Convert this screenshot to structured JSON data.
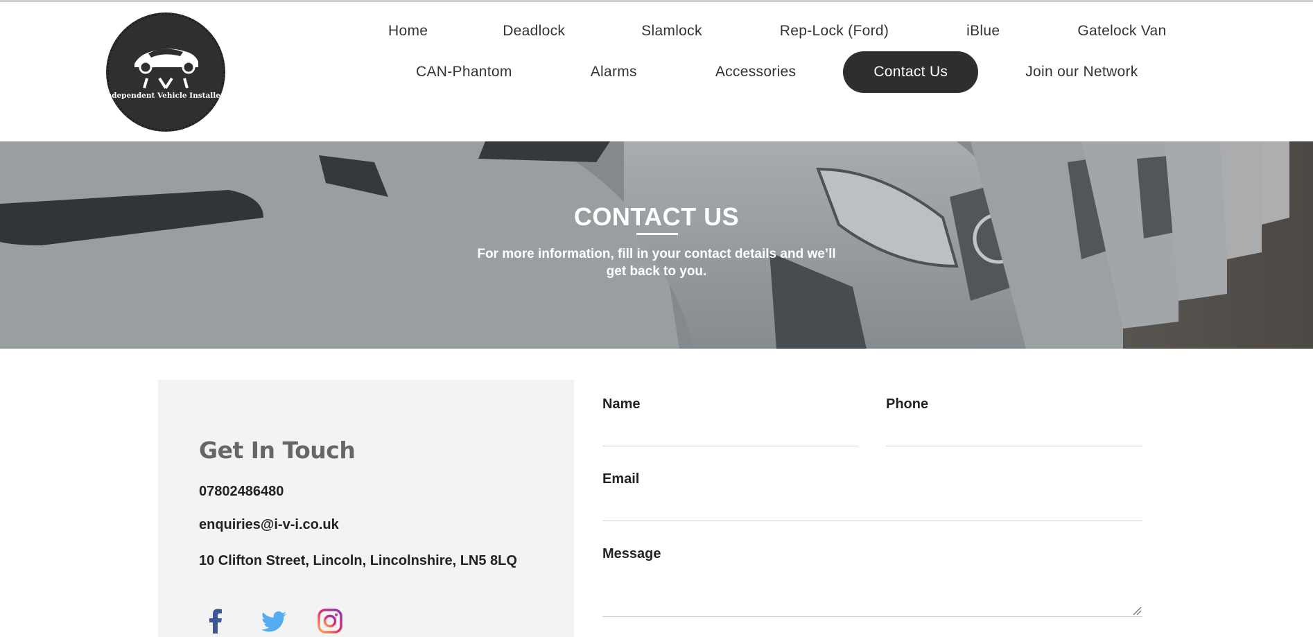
{
  "logo": {
    "text": "Independent Vehicle Installers",
    "mark": "IVI"
  },
  "nav": {
    "row1": [
      "Home",
      "Deadlock",
      "Slamlock",
      "Rep-Lock (Ford)",
      "iBlue",
      "Gatelock Van"
    ],
    "row2": [
      "CAN-Phantom",
      "Alarms",
      "Accessories",
      "Contact Us",
      "Join our Network"
    ],
    "active": "Contact Us"
  },
  "hero": {
    "title": "CONTACT US",
    "subtitle": "For more information, fill in your contact details and we’ll get back to you."
  },
  "contact": {
    "title": "Get In Touch",
    "phone": "07802486480",
    "email": "enquiries@i-v-i.co.uk",
    "address": "10 Clifton Street, Lincoln, Lincolnshire, LN5 8LQ",
    "social": [
      "facebook-icon",
      "twitter-icon",
      "instagram-icon"
    ]
  },
  "form": {
    "name_label": "Name",
    "phone_label": "Phone",
    "email_label": "Email",
    "message_label": "Message"
  },
  "colors": {
    "nav_active_bg": "#2e2e2e",
    "card_bg": "#f3f3f3",
    "facebook": "#3b5998",
    "twitter": "#55acee"
  }
}
